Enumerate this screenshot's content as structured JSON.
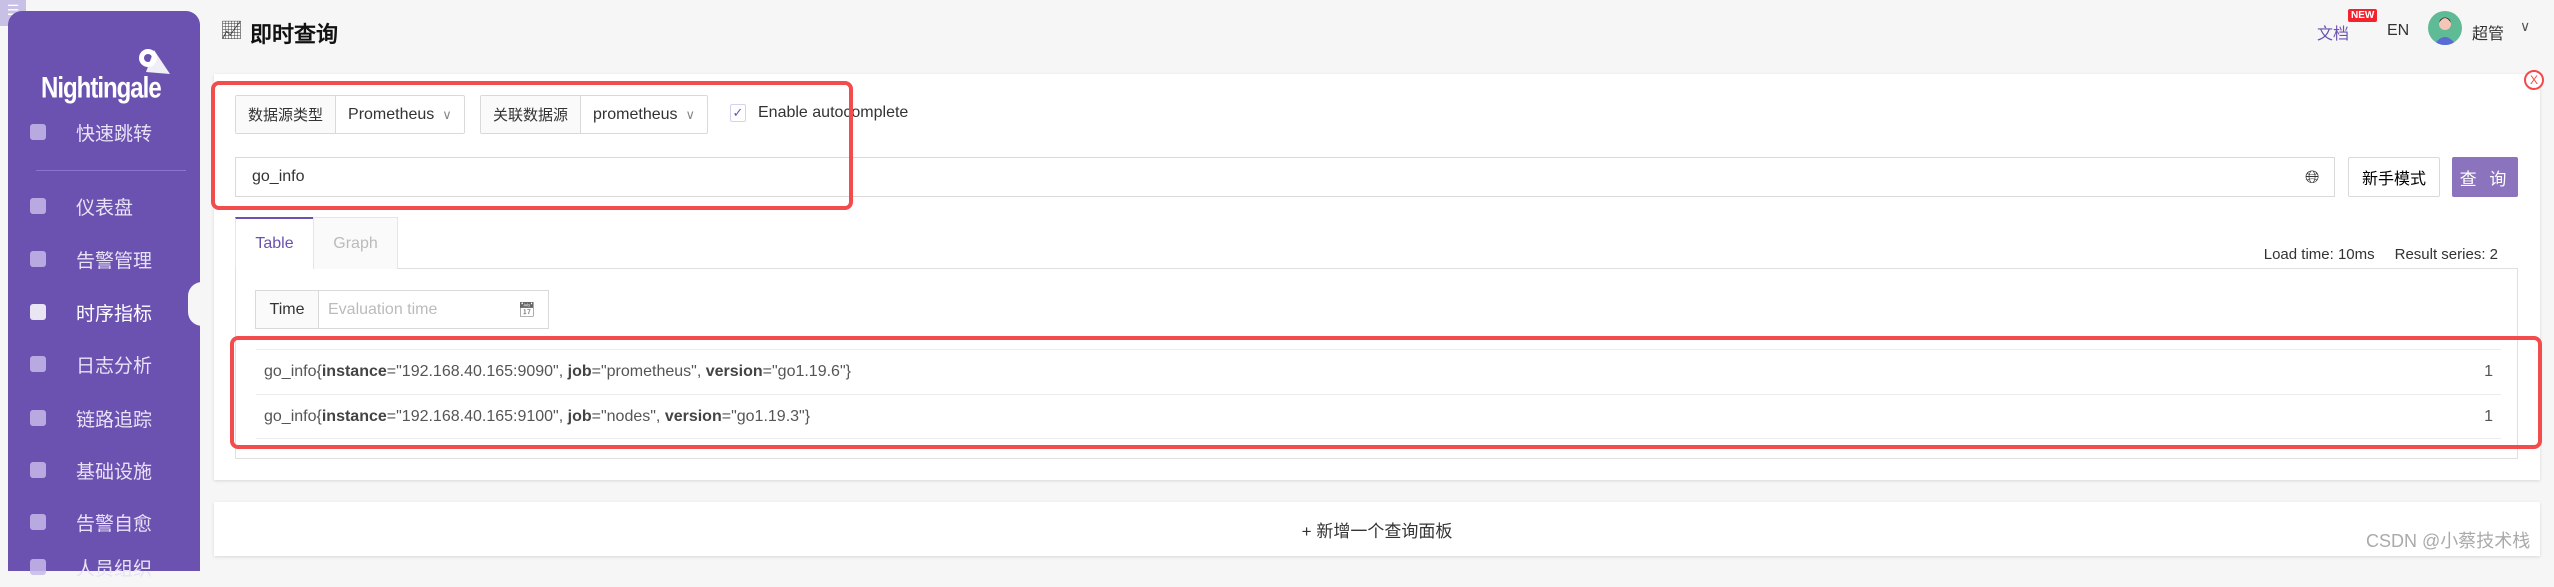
{
  "app": {
    "logo": "Nightingale",
    "page_title": "即时查询"
  },
  "header": {
    "docs": "文档",
    "new_badge": "NEW",
    "lang": "EN",
    "user": "超管"
  },
  "sidebar": {
    "items": [
      {
        "label": "快速跳转",
        "icon": "search-icon"
      },
      {
        "label": "仪表盘",
        "icon": "dashboard-icon"
      },
      {
        "label": "告警管理",
        "icon": "alarm-icon"
      },
      {
        "label": "时序指标",
        "icon": "chart-icon",
        "active": true
      },
      {
        "label": "日志分析",
        "icon": "document-icon"
      },
      {
        "label": "链路追踪",
        "icon": "link-icon"
      },
      {
        "label": "基础设施",
        "icon": "target-icon"
      },
      {
        "label": "告警自愈",
        "icon": "terminal-icon"
      },
      {
        "label": "人员组织",
        "icon": "user-icon"
      }
    ]
  },
  "query": {
    "datasource_type_label": "数据源类型",
    "datasource_type": "Prometheus",
    "datasource_label": "关联数据源",
    "datasource": "prometheus",
    "autocomplete_label": "Enable autocomplete",
    "autocomplete": true,
    "expression": "go_info",
    "novice_button": "新手模式",
    "run_button": "查 询"
  },
  "tabs": [
    {
      "label": "Table",
      "active": true
    },
    {
      "label": "Graph"
    }
  ],
  "stats": {
    "load_time": "Load time: 10ms",
    "result_series": "Result series: 2"
  },
  "time": {
    "label": "Time",
    "placeholder": "Evaluation time"
  },
  "results": [
    {
      "metric": "go_info",
      "labels": [
        [
          "instance",
          "\"192.168.40.165:9090\""
        ],
        [
          "job",
          "\"prometheus\""
        ],
        [
          "version",
          "\"go1.19.6\""
        ]
      ],
      "value": "1"
    },
    {
      "metric": "go_info",
      "labels": [
        [
          "instance",
          "\"192.168.40.165:9100\""
        ],
        [
          "job",
          "\"nodes\""
        ],
        [
          "version",
          "\"go1.19.3\""
        ]
      ],
      "value": "1"
    }
  ],
  "add_panel": "+  新增一个查询面板",
  "watermark": "CSDN @小蔡技术栈",
  "colors": {
    "sidebar": "#6b52b0",
    "primary_button": "#8c73bd",
    "highlight_box": "#f24c4c"
  }
}
